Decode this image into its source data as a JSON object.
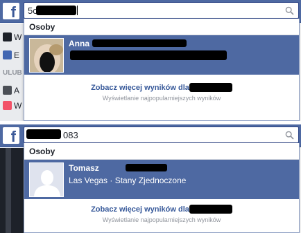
{
  "top": {
    "query": "5c",
    "section_label": "Osoby",
    "result": {
      "name": "Anna",
      "subtitle": ""
    },
    "more_link": "Zobacz więcej wyników dla",
    "more_sub": "Wyświetlanie najpopularniejszych wyników",
    "sidebar": {
      "row1": "W",
      "row2": "E",
      "heading": "ULUB",
      "row3": "A",
      "row4": "W"
    }
  },
  "bottom": {
    "query": "083",
    "section_label": "Osoby",
    "result": {
      "name": "Tomasz",
      "subtitle": "Las Vegas · Stany Zjednoczone"
    },
    "more_link": "Zobacz więcej wyników dla",
    "more_sub": "Wyświetlanie najpopularniejszych wyników"
  },
  "icons": [
    "facebook-logo-icon",
    "search-icon",
    "default-avatar-icon"
  ],
  "colors": {
    "header_blue": "#4e69a2",
    "link_blue": "#365899",
    "muted": "#90949c"
  }
}
